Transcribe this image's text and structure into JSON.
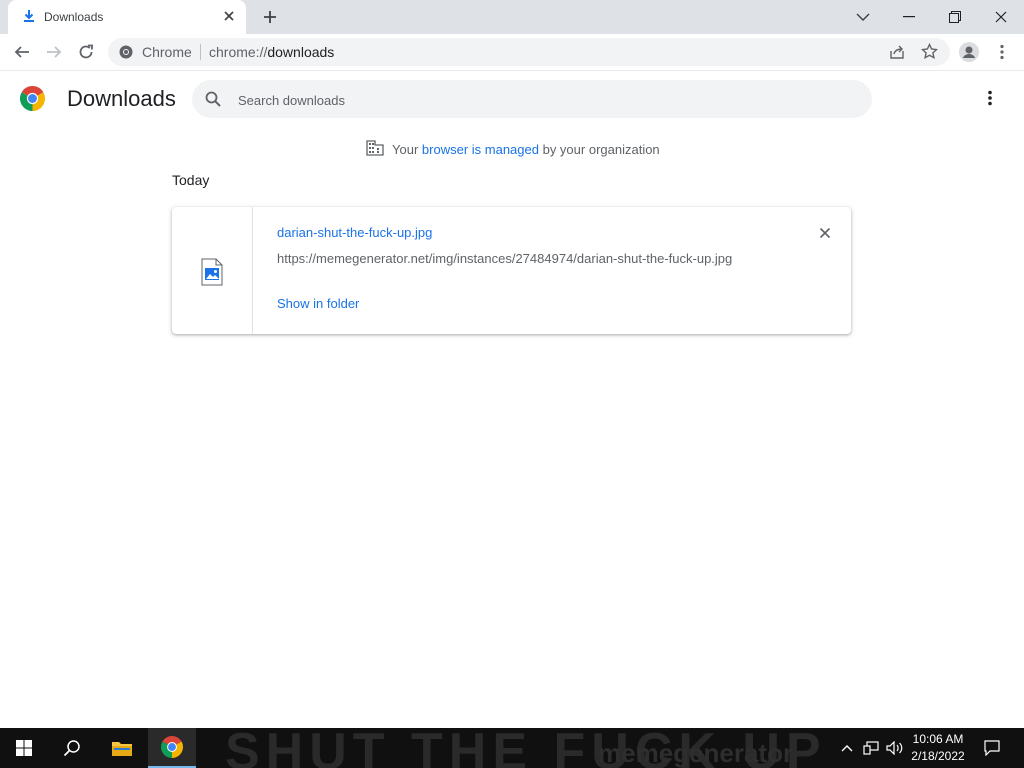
{
  "tab": {
    "title": "Downloads"
  },
  "omnibox": {
    "chip": "Chrome",
    "scheme": "chrome://",
    "path": "downloads"
  },
  "page": {
    "title": "Downloads",
    "search_placeholder": "Search downloads",
    "managed": {
      "before": "Your",
      "link": "browser is managed",
      "after": "by your organization"
    },
    "section": "Today"
  },
  "download": {
    "file_name": "darian-shut-the-fuck-up.jpg",
    "url": "https://memegenerator.net/img/instances/27484974/darian-shut-the-fuck-up.jpg",
    "show_in_folder": "Show in folder"
  },
  "taskbar": {
    "wallpaper_text": "SHUT THE FUCK UP",
    "wallpaper_sub": "memegenerator",
    "time": "10:06 AM",
    "date": "2/18/2022"
  },
  "colors": {
    "accent": "#1a73e8",
    "tabstrip": "#dee1e6",
    "taskbar": "#101010"
  }
}
